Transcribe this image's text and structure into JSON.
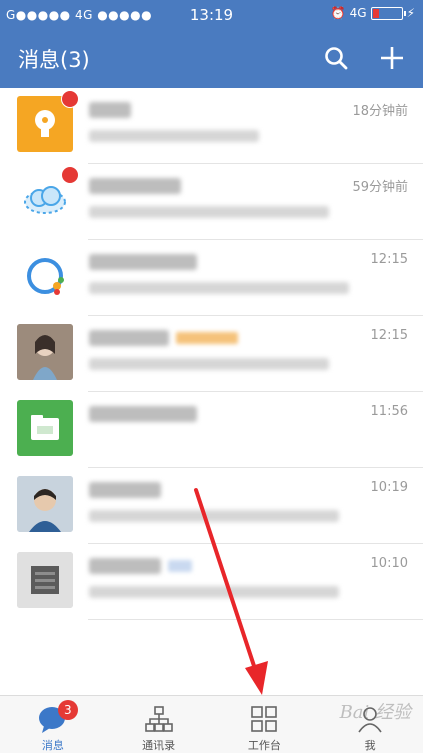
{
  "status_bar": {
    "carrier": "G●●●●● 4G ●●●●●",
    "time": "13:19",
    "network": "4G"
  },
  "header": {
    "title": "消息(3)",
    "search_icon": "search-icon",
    "add_icon": "plus-icon"
  },
  "messages": [
    {
      "time": "18分钟前",
      "badge": "",
      "avatar": "bulb-icon"
    },
    {
      "time": "59分钟前",
      "badge": "",
      "avatar": "cloud-icon"
    },
    {
      "time": "12:15",
      "avatar": "circle-logo-icon"
    },
    {
      "time": "12:15",
      "avatar": "person-photo"
    },
    {
      "time": "11:56",
      "avatar": "folder-icon"
    },
    {
      "time": "10:19",
      "avatar": "person-photo"
    },
    {
      "time": "10:10",
      "avatar": "group-photo"
    }
  ],
  "tabs": [
    {
      "label": "消息",
      "badge": "3",
      "icon": "chat-icon"
    },
    {
      "label": "通讯录",
      "icon": "org-chart-icon"
    },
    {
      "label": "工作台",
      "icon": "grid-icon"
    },
    {
      "label": "我",
      "icon": "person-icon"
    }
  ],
  "watermark": "Bai 经验",
  "colors": {
    "header": "#4a7bc0",
    "accent": "#3c78c8",
    "badge": "#e53935",
    "annotation_arrow": "#e8262a"
  }
}
